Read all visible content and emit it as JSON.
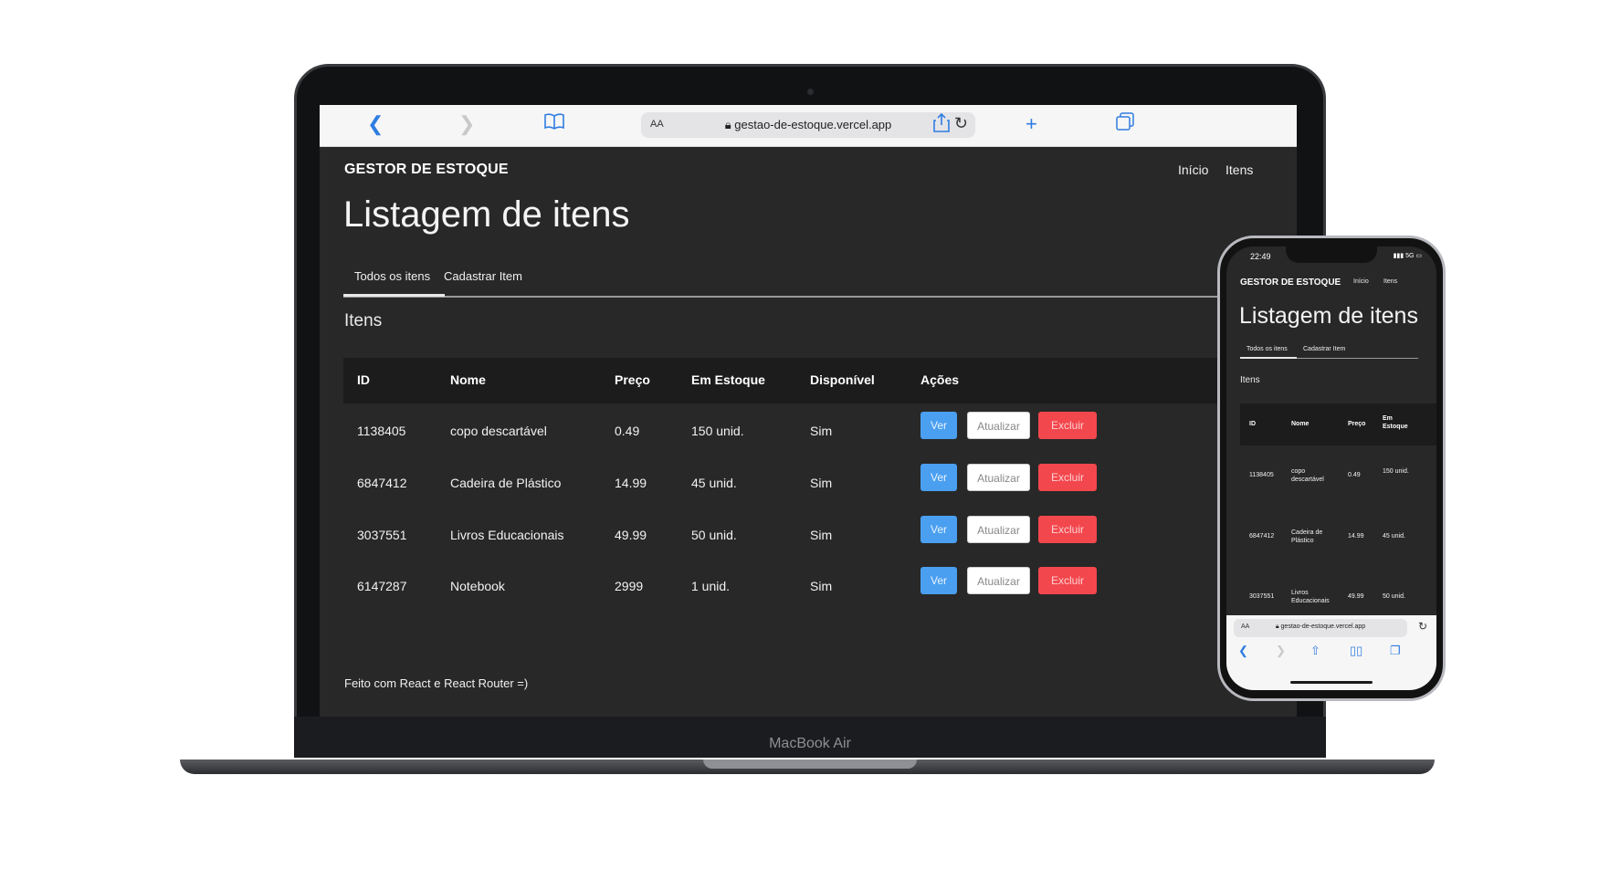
{
  "device_label": "MacBook Air",
  "browser": {
    "text_size_label": "AA",
    "url": "gestao-de-estoque.vercel.app",
    "icons": {
      "back": "chevron-left-icon",
      "forward": "chevron-right-icon",
      "bookmarks": "book-icon",
      "share": "share-icon",
      "new_tab": "plus-icon",
      "tabs": "tabs-icon",
      "reload": "reload-icon",
      "lock": "lock-icon"
    }
  },
  "app": {
    "brand": "GESTOR DE ESTOQUE",
    "nav": [
      "Início",
      "Itens"
    ],
    "page_title": "Listagem de itens",
    "tabs": [
      "Todos os itens",
      "Cadastrar Item"
    ],
    "section_title": "Itens",
    "table": {
      "headers": [
        "ID",
        "Nome",
        "Preço",
        "Em Estoque",
        "Disponível",
        "Ações"
      ],
      "rows": [
        {
          "id": "1138405",
          "nome": "copo descartável",
          "preco": "0.49",
          "estoque": "150 unid.",
          "disponivel": "Sim"
        },
        {
          "id": "6847412",
          "nome": "Cadeira de Plástico",
          "preco": "14.99",
          "estoque": "45 unid.",
          "disponivel": "Sim"
        },
        {
          "id": "3037551",
          "nome": "Livros Educacionais",
          "preco": "49.99",
          "estoque": "50 unid.",
          "disponivel": "Sim"
        },
        {
          "id": "6147287",
          "nome": "Notebook",
          "preco": "2999",
          "estoque": "1 unid.",
          "disponivel": "Sim"
        }
      ],
      "actions": {
        "view": "Ver",
        "update": "Atualizar",
        "delete": "Excluir"
      }
    },
    "footer": "Feito com React e React Router =)"
  },
  "phone": {
    "time": "22:49",
    "signal": "5G",
    "headers": [
      "ID",
      "Nome",
      "Preço",
      "Em Estoque"
    ],
    "rows": [
      {
        "id": "1138405",
        "nome": "copo descartável",
        "preco": "0.49",
        "estoque": "150 unid."
      },
      {
        "id": "6847412",
        "nome": "Cadeira de Plástico",
        "preco": "14.99",
        "estoque": "45 unid."
      },
      {
        "id": "3037551",
        "nome": "Livros Educacionais",
        "preco": "49.99",
        "estoque": "50 unid."
      }
    ]
  },
  "colors": {
    "app_bg": "#282828",
    "header_bg": "#1c1c1c",
    "ver": "#4a9ff0",
    "excluir": "#f2474d",
    "safari_blue": "#2f7de1"
  }
}
